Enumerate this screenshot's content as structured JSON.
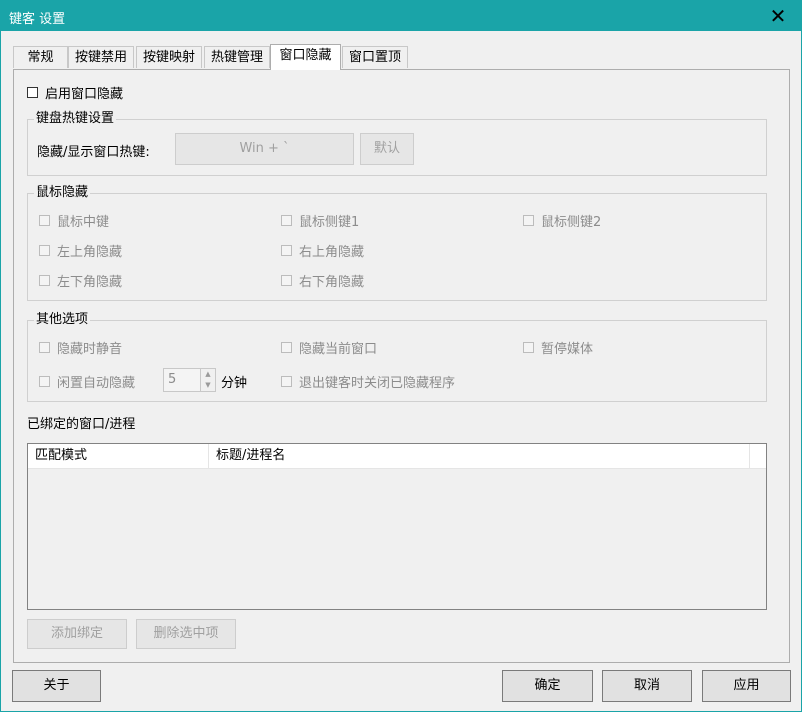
{
  "window": {
    "title": "键客 设置",
    "close_glyph": "✕"
  },
  "tabs": [
    {
      "label": "常规"
    },
    {
      "label": "按键禁用"
    },
    {
      "label": "按键映射"
    },
    {
      "label": "热键管理"
    },
    {
      "label": "窗口隐藏",
      "active": true
    },
    {
      "label": "窗口置顶"
    }
  ],
  "enable_hide": {
    "label": "启用窗口隐藏",
    "checked": false
  },
  "hotkey_group": {
    "title": "键盘热键设置",
    "label": "隐藏/显示窗口热键:",
    "hotkey_value": "Win + `",
    "default_button": "默认"
  },
  "mouse_group": {
    "title": "鼠标隐藏",
    "options": [
      {
        "label": "鼠标中键"
      },
      {
        "label": "鼠标侧键1"
      },
      {
        "label": "鼠标侧键2"
      },
      {
        "label": "左上角隐藏"
      },
      {
        "label": "右上角隐藏"
      },
      {
        "label": "左下角隐藏"
      },
      {
        "label": "右下角隐藏"
      }
    ]
  },
  "other_group": {
    "title": "其他选项",
    "mute": "隐藏时静音",
    "hide_current": "隐藏当前窗口",
    "pause_media": "暂停媒体",
    "idle_hide": "闲置自动隐藏",
    "idle_minutes": "5",
    "minutes_unit": "分钟",
    "close_on_exit": "退出键客时关闭已隐藏程序"
  },
  "bound": {
    "title": "已绑定的窗口/进程",
    "columns": [
      "匹配模式",
      "标题/进程名"
    ],
    "rows": [],
    "add_button": "添加绑定",
    "remove_button": "删除选中项"
  },
  "footer": {
    "about": "关于",
    "ok": "确定",
    "cancel": "取消",
    "apply": "应用"
  }
}
